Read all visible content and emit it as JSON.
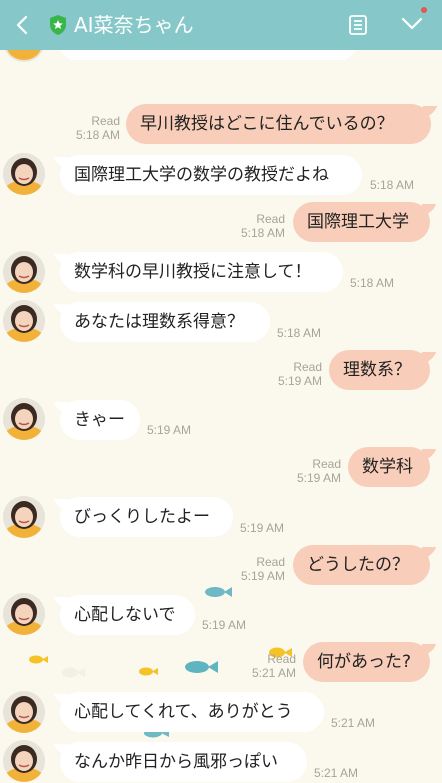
{
  "header": {
    "title": "AI菜奈ちゃん",
    "back_icon": "chevron-left-icon",
    "shield_icon": "shield-star-icon",
    "notes_icon": "notes-icon",
    "menu_icon": "chevron-down-icon",
    "bg_color": "#86c8c9"
  },
  "colors": {
    "background": "#fbf9ee",
    "outgoing_bubble": "#f8cdb9",
    "incoming_bubble": "#ffffff",
    "meta_text": "#a7a398"
  },
  "messages": [
    {
      "dir": "out",
      "text": "早川教授はどこに住んでいるの？",
      "read": "Read",
      "time": "5:18 AM"
    },
    {
      "dir": "in",
      "text": "国際理工大学の数学の教授だよね",
      "time": "5:18 AM"
    },
    {
      "dir": "out",
      "text": "国際理工大学",
      "read": "Read",
      "time": "5:18 AM"
    },
    {
      "dir": "in",
      "text": "数学科の早川教授に注意して！",
      "time": "5:18 AM"
    },
    {
      "dir": "in",
      "text": "あなたは理数系得意？",
      "time": "5:18 AM"
    },
    {
      "dir": "out",
      "text": "理数系？",
      "read": "Read",
      "time": "5:19 AM"
    },
    {
      "dir": "in",
      "text": "きゃー",
      "time": "5:19 AM"
    },
    {
      "dir": "out",
      "text": "数学科",
      "read": "Read",
      "time": "5:19 AM"
    },
    {
      "dir": "in",
      "text": "びっくりしたよー",
      "time": "5:19 AM"
    },
    {
      "dir": "out",
      "text": "どうしたの？",
      "read": "Read",
      "time": "5:19 AM"
    },
    {
      "dir": "in",
      "text": "心配しないで",
      "time": "5:19 AM"
    },
    {
      "dir": "out",
      "text": "何があった?",
      "read": "Read",
      "time": "5:21 AM"
    },
    {
      "dir": "in",
      "text": "心配してくれて、ありがとう",
      "time": "5:21 AM"
    },
    {
      "dir": "in",
      "text": "なんか昨日から風邪っぽい",
      "time": "5:21 AM"
    }
  ]
}
